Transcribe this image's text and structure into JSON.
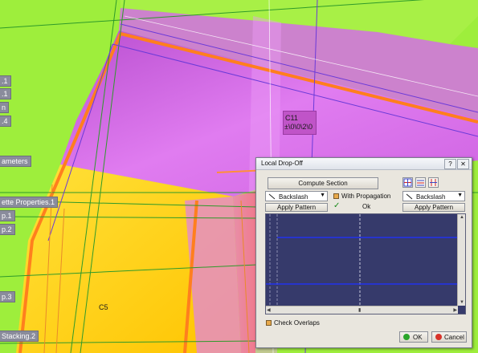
{
  "tree": {
    "labels": [
      ".1",
      ".1",
      "n",
      ".4",
      "ameters",
      "ette Properties.1",
      "p.1",
      "p.2",
      "p.3",
      "Stacking.2"
    ]
  },
  "canvas": {
    "zone_c11": "C11",
    "zone_c11_value": "±\\0\\0\\2\\0",
    "zone_c5": "C5"
  },
  "dialog": {
    "title": "Local Drop-Off",
    "help_glyph": "?",
    "close_glyph": "✕",
    "compute_section": "Compute Section",
    "left_pattern": "Backslash",
    "right_pattern": "Backslash",
    "apply_pattern_left": "Apply Pattern",
    "apply_pattern_right": "Apply Pattern",
    "with_propagation": "With Propagation",
    "ok_inline": "Ok",
    "check_overlaps": "Check Overlaps",
    "ok": "OK",
    "cancel": "Cancel"
  },
  "colors": {
    "green_ply": "#9eee3c",
    "magenta_ply": "#d46ee6",
    "yellow_ply": "#ffd21f",
    "orange_edge": "#ff7f1e",
    "graph_bg": "#363a6b",
    "graph_line": "#2233ee"
  }
}
